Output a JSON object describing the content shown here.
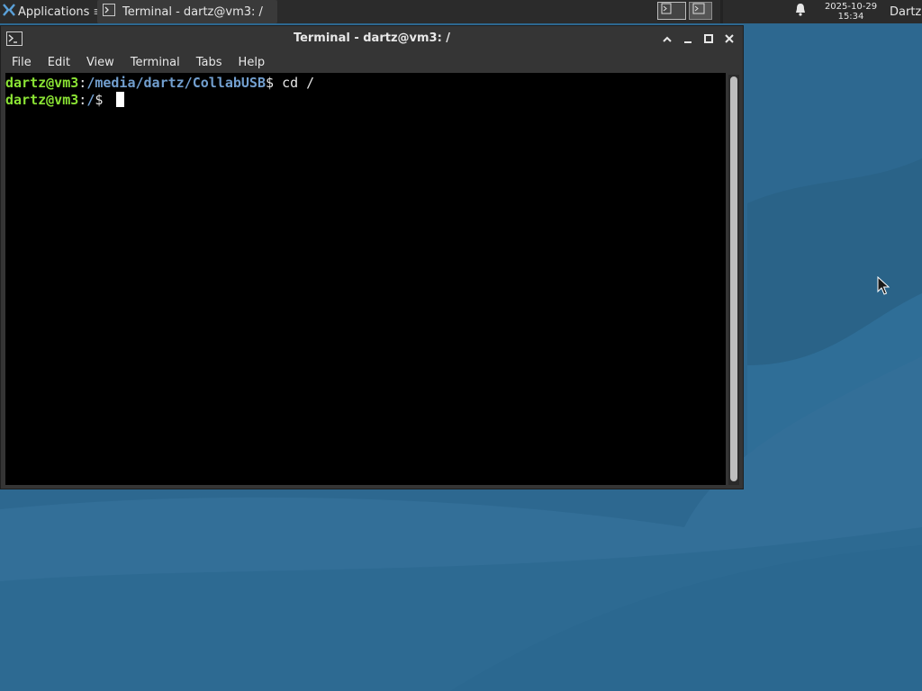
{
  "panel": {
    "applications_label": "Applications",
    "task_label": "Terminal - dartz@vm3: /",
    "clock_date": "2025-10-29",
    "clock_time": "15:34",
    "user_label": "Dartz"
  },
  "window": {
    "title": "Terminal - dartz@vm3: /",
    "menu": [
      "File",
      "Edit",
      "View",
      "Terminal",
      "Tabs",
      "Help"
    ]
  },
  "terminal": {
    "lines": [
      {
        "user": "dartz@vm3",
        "sep": ":",
        "path": "/media/dartz/CollabUSB",
        "prompt": "$ ",
        "cmd": "cd /"
      },
      {
        "user": "dartz@vm3",
        "sep": ":",
        "path": "/",
        "prompt": "$ ",
        "cmd": ""
      }
    ]
  },
  "colors": {
    "prompt_user": "#8ae234",
    "prompt_path": "#729fcf",
    "desktop": "#2f6b93"
  },
  "icons": [
    "applications-menu-icon",
    "terminal-task-icon",
    "workspace-icon",
    "notification-bell-icon",
    "terminal-window-icon",
    "shade-icon",
    "minimize-icon",
    "maximize-icon",
    "close-icon",
    "mouse-pointer-icon"
  ]
}
